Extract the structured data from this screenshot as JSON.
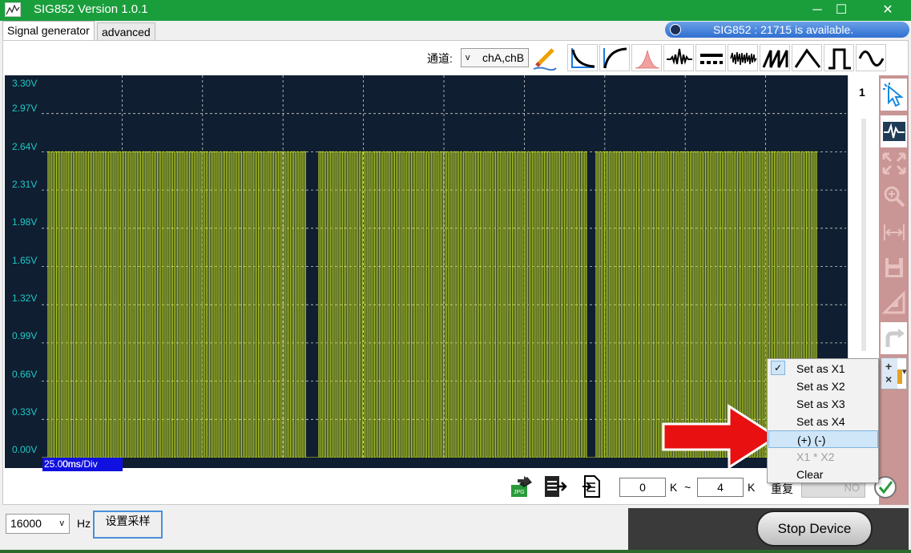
{
  "window": {
    "title": "SIG852  Version 1.0.1",
    "controls": [
      "─",
      "☐",
      "✕"
    ]
  },
  "tabs": [
    {
      "label": "Signal generator",
      "active": true
    },
    {
      "label": "advanced",
      "active": false
    }
  ],
  "status": {
    "text": "SIG852 : 21715 is available."
  },
  "toolbar": {
    "channel_label": "通道:",
    "channel_value": "chA,chB",
    "channel_chevron": "v",
    "waveform_icons": [
      "pencil-icon",
      "exp-decay-icon",
      "exp-rise-icon",
      "gaussian-icon",
      "sinc-icon",
      "dc-icon",
      "noise-icon",
      "sawtooth-icon",
      "triangle-icon",
      "square-icon",
      "sine-icon"
    ]
  },
  "scope": {
    "y_labels": [
      "3.30V",
      "2.97V",
      "2.64V",
      "2.31V",
      "1.98V",
      "1.65V",
      "1.32V",
      "0.99V",
      "0.66V",
      "0.33V",
      "0.00V"
    ],
    "time_div": "25.00ms/Div",
    "overlap_text": "0ms",
    "trace_color": "#c8e020",
    "background": "#0f1e30",
    "grid_color": "#d0d0d0"
  },
  "chart_data": {
    "type": "line",
    "ylim": [
      0,
      3.3
    ],
    "pulse_high": 2.64,
    "pulse_low": 0
  },
  "sidebar": {
    "page_number": "1",
    "icons": [
      "pointer-icon",
      "waveform-view-icon",
      "fit-screen-icon",
      "zoom-in-icon",
      "horizontal-measure-icon",
      "save-icon",
      "ruler-icon",
      "redo-icon",
      "cursor-add-icon"
    ],
    "cursor_plus": "+",
    "cursor_cross": "×",
    "cursor_dd": "▾"
  },
  "context_menu": {
    "check": "✓",
    "items": [
      {
        "label": "Set as X1",
        "checked": true,
        "highlighted": false,
        "enabled": true
      },
      {
        "label": "Set as X2",
        "checked": false,
        "highlighted": false,
        "enabled": true
      },
      {
        "label": "Set as X3",
        "checked": false,
        "highlighted": false,
        "enabled": true
      },
      {
        "label": "Set as X4",
        "checked": false,
        "highlighted": false,
        "enabled": true
      },
      {
        "label": "(+)  (-)",
        "checked": false,
        "highlighted": true,
        "enabled": true
      },
      {
        "label": "X1 * X2",
        "checked": false,
        "highlighted": false,
        "enabled": false
      },
      {
        "label": "Clear",
        "checked": false,
        "highlighted": false,
        "enabled": true
      }
    ]
  },
  "bottom_tools": {
    "from_value": "0",
    "to_value": "4",
    "k1": "K",
    "tilde": "~",
    "k2": "K",
    "repeat_label": "重复",
    "repeat_value": "NO",
    "jpg_label": "JPG"
  },
  "footer": {
    "sample_rate": "16000",
    "rate_chevron": "v",
    "hz": "Hz",
    "set_rate_label": "设置采样",
    "stop_device_label": "Stop Device"
  },
  "annotation": {
    "arrow_color": "#e81010"
  }
}
